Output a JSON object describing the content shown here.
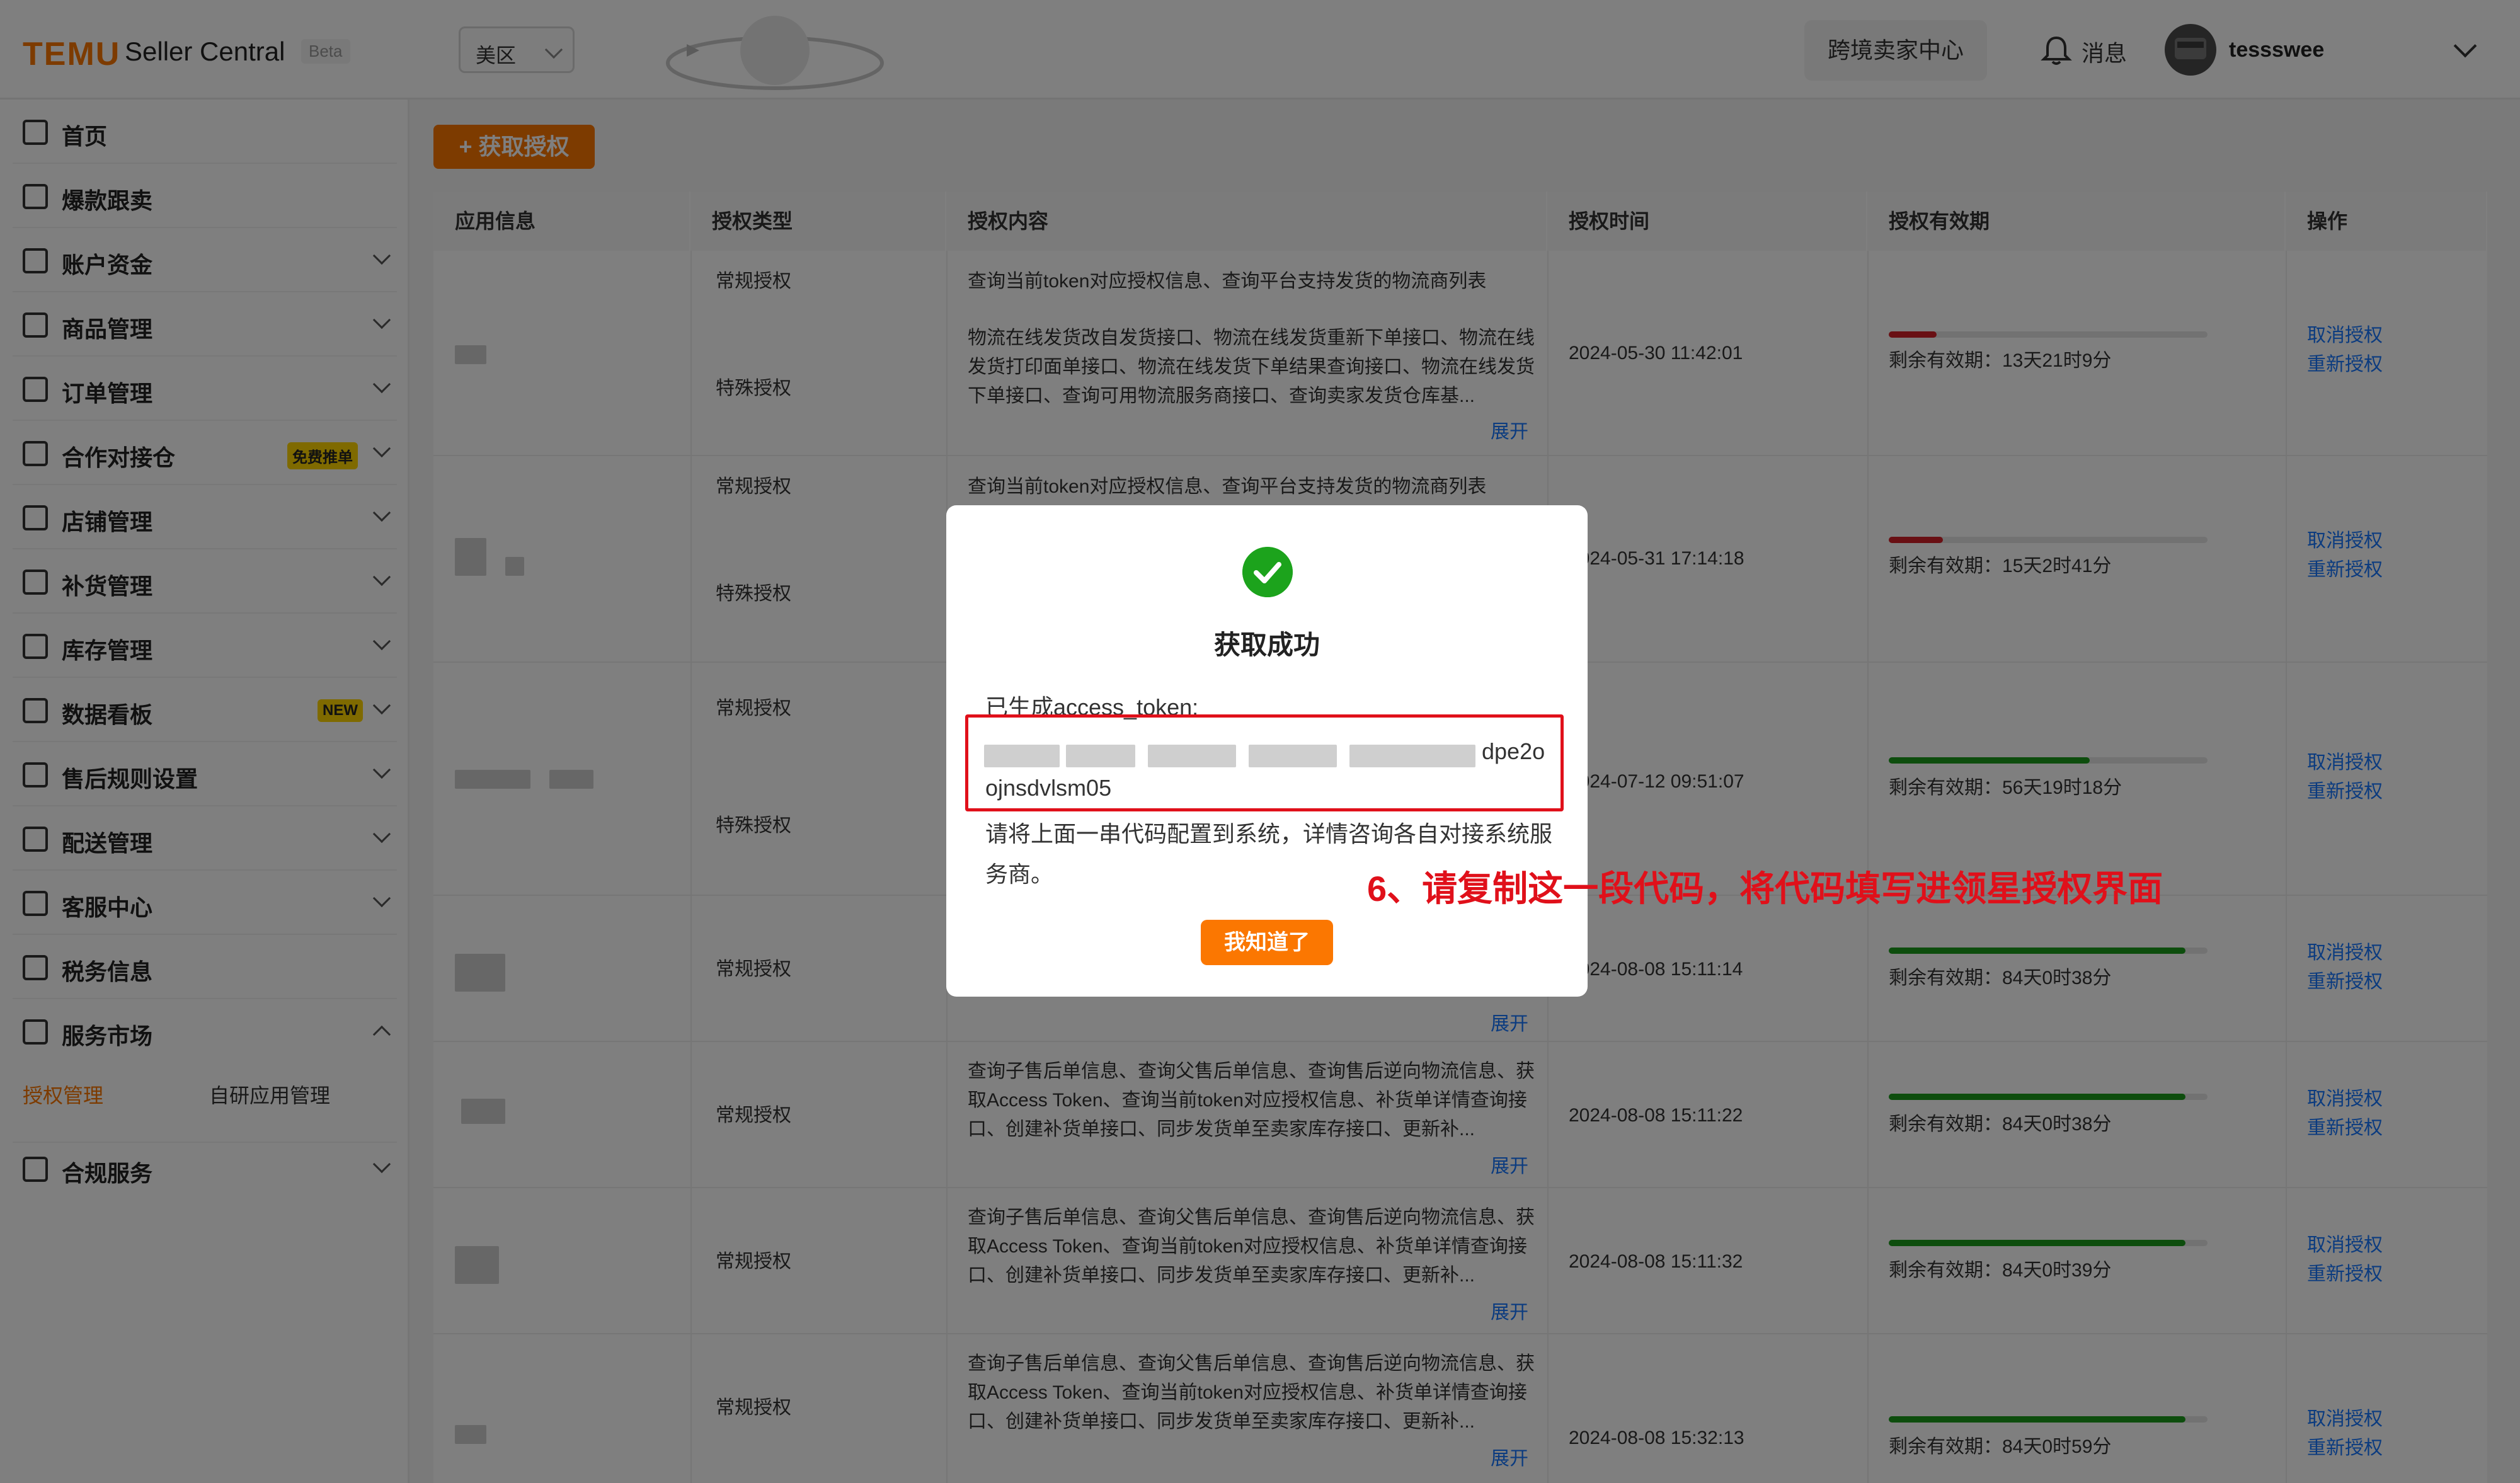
{
  "header": {
    "logo": "TEMU",
    "app_name": "Seller Central",
    "beta": "Beta",
    "region": "美区",
    "cross_border_btn": "跨境卖家中心",
    "messages": "消息",
    "username": "tessswee"
  },
  "sidebar": {
    "items": [
      {
        "label": "首页",
        "icon": "home-icon",
        "has_arrow": false
      },
      {
        "label": "爆款跟卖",
        "icon": "cart-icon",
        "has_arrow": false
      },
      {
        "label": "账户资金",
        "icon": "wallet-icon",
        "has_arrow": true
      },
      {
        "label": "商品管理",
        "icon": "product-icon",
        "has_arrow": true
      },
      {
        "label": "订单管理",
        "icon": "order-icon",
        "has_arrow": true
      },
      {
        "label": "合作对接仓",
        "icon": "warehouse-icon",
        "has_arrow": true,
        "badge": "免费推单"
      },
      {
        "label": "店铺管理",
        "icon": "store-icon",
        "has_arrow": true
      },
      {
        "label": "补货管理",
        "icon": "restock-icon",
        "has_arrow": true
      },
      {
        "label": "库存管理",
        "icon": "inventory-icon",
        "has_arrow": true
      },
      {
        "label": "数据看板",
        "icon": "dashboard-icon",
        "has_arrow": true,
        "badge": "NEW"
      },
      {
        "label": "售后规则设置",
        "icon": "aftersale-icon",
        "has_arrow": true
      },
      {
        "label": "配送管理",
        "icon": "truck-icon",
        "has_arrow": true
      },
      {
        "label": "客服中心",
        "icon": "chat-icon",
        "has_arrow": true
      },
      {
        "label": "税务信息",
        "icon": "tax-icon",
        "has_arrow": false
      },
      {
        "label": "服务市场",
        "icon": "shield-icon",
        "has_arrow": true,
        "expanded": true
      },
      {
        "label": "合规服务",
        "icon": "compliance-icon",
        "has_arrow": true
      }
    ],
    "sub_items": [
      "授权管理",
      "自研应用管理"
    ],
    "active_sub": "授权管理"
  },
  "main": {
    "get_auth_btn": "获取授权",
    "columns": [
      "应用信息",
      "授权类型",
      "授权内容",
      "授权时间",
      "授权有效期",
      "操作"
    ],
    "rows": [
      {
        "type1": "常规授权",
        "content1": "查询当前token对应授权信息、查询平台支持发货的物流商列表",
        "type2": "特殊授权",
        "content2": "物流在线发货改自发货接口、物流在线发货重新下单接口、物流在线发货打印面单接口、物流在线发货下单结果查询接口、物流在线发货下单接口、查询可用物流服务商接口、查询卖家发货仓库基...",
        "expand": "展开",
        "time": "2024-05-30 11:42:01",
        "remaining": "剩余有效期：13天21时9分",
        "progress": 0.15,
        "bar_color": "#d32029",
        "cancel": "取消授权",
        "reauth": "重新授权"
      },
      {
        "type1": "常规授权",
        "content1": "查询当前token对应授权信息、查询平台支持发货的物流商列表",
        "type2": "特殊授权",
        "time": "2024-05-31 17:14:18",
        "remaining": "剩余有效期：15天2时41分",
        "progress": 0.17,
        "bar_color": "#d32029",
        "cancel": "取消授权",
        "reauth": "重新授权"
      },
      {
        "type1": "常规授权",
        "type2": "特殊授权",
        "time": "2024-07-12 09:51:07",
        "remaining": "剩余有效期：56天19时18分",
        "progress": 0.63,
        "bar_color": "#1a9a1a",
        "cancel": "取消授权",
        "reauth": "重新授权"
      },
      {
        "type1": "常规授权",
        "expand": "展开",
        "time": "2024-08-08 15:11:14",
        "remaining": "剩余有效期：84天0时38分",
        "progress": 0.93,
        "bar_color": "#1a9a1a",
        "cancel": "取消授权",
        "reauth": "重新授权"
      },
      {
        "type1": "常规授权",
        "content1": "查询子售后单信息、查询父售后单信息、查询售后逆向物流信息、获取Access Token、查询当前token对应授权信息、补货单详情查询接口、创建补货单接口、同步发货单至卖家库存接口、更新补...",
        "expand": "展开",
        "time": "2024-08-08 15:11:22",
        "remaining": "剩余有效期：84天0时38分",
        "progress": 0.93,
        "bar_color": "#1a9a1a",
        "cancel": "取消授权",
        "reauth": "重新授权"
      },
      {
        "type1": "常规授权",
        "content1": "查询子售后单信息、查询父售后单信息、查询售后逆向物流信息、获取Access Token、查询当前token对应授权信息、补货单详情查询接口、创建补货单接口、同步发货单至卖家库存接口、更新补...",
        "expand": "展开",
        "time": "2024-08-08 15:11:32",
        "remaining": "剩余有效期：84天0时39分",
        "progress": 0.93,
        "bar_color": "#1a9a1a",
        "cancel": "取消授权",
        "reauth": "重新授权"
      },
      {
        "type1": "常规授权",
        "content1": "查询子售后单信息、查询父售后单信息、查询售后逆向物流信息、获取Access Token、查询当前token对应授权信息、补货单详情查询接口、创建补货单接口、同步发货单至卖家库存接口、更新补...",
        "expand": "展开",
        "time": "2024-08-08 15:32:13",
        "remaining": "剩余有效期：84天0时59分",
        "progress": 0.93,
        "bar_color": "#1a9a1a",
        "cancel": "取消授权",
        "reauth": "重新授权"
      }
    ]
  },
  "modal": {
    "title": "获取成功",
    "label": "已生成access_token:",
    "token_line1_visible": "dpe2o",
    "token_line2": "ojnsdvlsm05",
    "desc": "请将上面一串代码配置到系统，详情咨询各自对接系统服务商。",
    "ok_btn": "我知道了",
    "success_color": "#1ca31c"
  },
  "annotation": "6、请复制这一段代码，将代码填写进领星授权界面",
  "colors": {
    "accent": "#fb7701",
    "link": "#1677ff",
    "annotation": "#e0101a"
  }
}
